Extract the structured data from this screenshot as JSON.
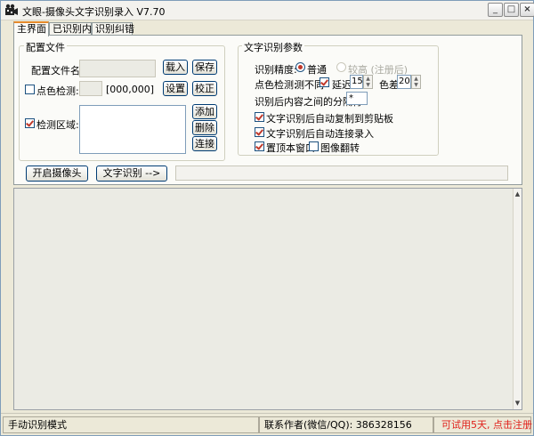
{
  "window": {
    "title": "文眼-摄像头文字识别录入 V7.70",
    "min_label": "_",
    "max_label": "□",
    "close_label": "×"
  },
  "tabs": [
    {
      "label": "主界面",
      "active": true
    },
    {
      "label": "已识别内容",
      "active": false
    },
    {
      "label": "识别纠错",
      "active": false
    }
  ],
  "config": {
    "legend": "配置文件",
    "config_name_label": "配置文件名:",
    "config_name_value": "",
    "load_button": "载入",
    "save_button": "保存",
    "color_detect_label": "点色检测:",
    "color_detect_checked": false,
    "color_coords": "[000,000]",
    "set_button": "设置",
    "calibrate_button": "校正",
    "detect_region_label": "检测区域:",
    "detect_region_checked": true,
    "add_button": "添加",
    "delete_button": "删除",
    "connect_button": "连接"
  },
  "recognition": {
    "legend": "文字识别参数",
    "accuracy_label": "识别精度:",
    "accuracy_normal": "普通",
    "accuracy_high": "较高 (注册后)",
    "color_detect_label": "点色检测:",
    "color_detect_option": "测不同",
    "color_detect_checked": true,
    "delay_label": "延迟",
    "delay_value": "15",
    "color_diff_label": "色差",
    "color_diff_value": "20",
    "separator_label": "识别后内容之间的分隔符:",
    "separator_value": "*",
    "opt_auto_copy": {
      "label": "文字识别后自动复制到剪贴板",
      "checked": true
    },
    "opt_auto_input": {
      "label": "文字识别后自动连接录入",
      "checked": true
    },
    "opt_topmost": {
      "label": "置顶本窗口",
      "checked": true
    },
    "opt_flip": {
      "label": "图像翻转",
      "checked": false
    }
  },
  "actions": {
    "open_camera": "开启摄像头",
    "recognize": "文字识别 -->",
    "result_value": ""
  },
  "output": {
    "text": "",
    "scroll_up": "▲",
    "scroll_down": "▼"
  },
  "status": {
    "mode": "手动识别模式",
    "contact": "联系作者(微信/QQ): 386328156",
    "trial": "可试用5天, 点击注册",
    "trial_color": "#e0201a"
  }
}
